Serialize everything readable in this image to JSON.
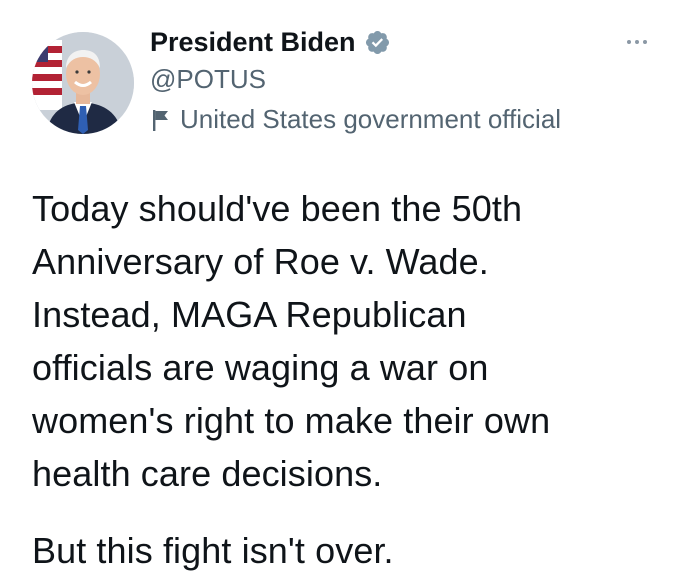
{
  "author": {
    "display_name": "President Biden",
    "handle": "@POTUS",
    "label": "United States government official",
    "verified": true,
    "avatar_icon": "portrait-avatar",
    "verified_icon": "verified-badge-icon",
    "label_icon": "flag-icon"
  },
  "more_menu_icon": "more-options-icon",
  "tweet": {
    "lines": [
      "Today should've been the 50th",
      "Anniversary of Roe v. Wade.",
      "Instead, MAGA Republican",
      "officials are waging a war on",
      "women's right to make their own",
      "health care decisions."
    ],
    "closing_line": "But this fight isn't over."
  },
  "colors": {
    "text_primary": "#0f1419",
    "text_secondary": "#536471",
    "verified_badge": "#829aab",
    "background": "#ffffff"
  }
}
